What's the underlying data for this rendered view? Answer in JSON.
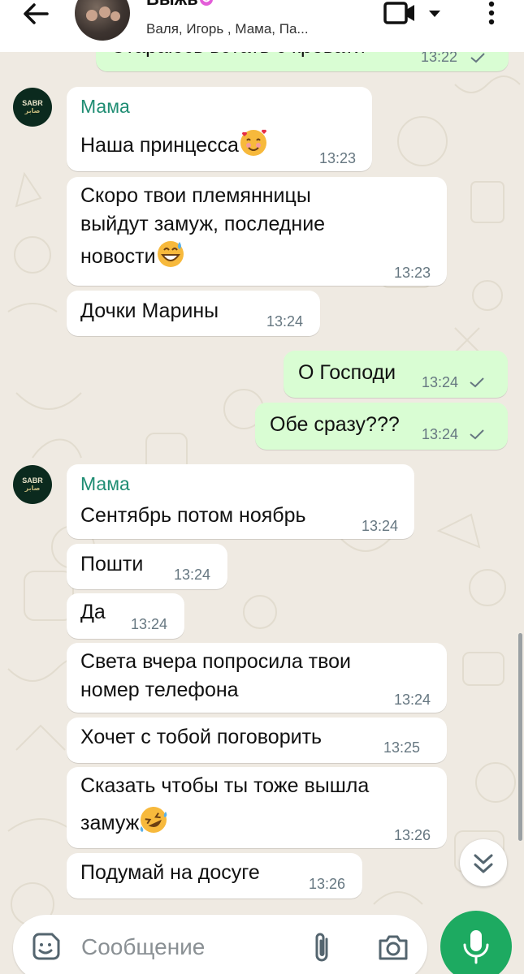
{
  "header": {
    "title": "Выжь",
    "members": "Валя, Игорь , Мама, Па..."
  },
  "messages": [
    {
      "dir": "out",
      "text": "Стараюсь встать с кровати",
      "time": "13:22",
      "status": "sent"
    },
    {
      "dir": "in",
      "sender": "Мама",
      "avatar_text": "SABR",
      "avatar_sub": "صابر",
      "lines": [
        "Наша принцесса"
      ],
      "emoji": "smiling-face-with-hearts",
      "time": "13:23"
    },
    {
      "dir": "in",
      "lines": [
        "Скоро твои племянницы",
        "выйдут замуж, последние",
        "новости"
      ],
      "emoji": "grinning-face-with-sweat",
      "time": "13:23"
    },
    {
      "dir": "in",
      "lines": [
        "Дочки Марины"
      ],
      "time": "13:24"
    },
    {
      "dir": "out",
      "text": "О Господи",
      "time": "13:24",
      "status": "sent"
    },
    {
      "dir": "out",
      "text": "Обе сразу???",
      "time": "13:24",
      "status": "sent"
    },
    {
      "dir": "in",
      "sender": "Мама",
      "avatar_text": "SABR",
      "avatar_sub": "صابر",
      "lines": [
        "Сентябрь потом ноябрь"
      ],
      "time": "13:24"
    },
    {
      "dir": "in",
      "lines": [
        "Пошти"
      ],
      "time": "13:24"
    },
    {
      "dir": "in",
      "lines": [
        "Да"
      ],
      "time": "13:24"
    },
    {
      "dir": "in",
      "lines": [
        "Света вчера попросила твои",
        "номер телефона"
      ],
      "time": "13:24"
    },
    {
      "dir": "in",
      "lines": [
        "Хочет с тобой поговорить"
      ],
      "time": "13:25"
    },
    {
      "dir": "in",
      "lines": [
        "Сказать чтобы ты тоже вышла",
        "замуж"
      ],
      "emoji": "rolling-on-floor-laughing",
      "time": "13:26"
    },
    {
      "dir": "in",
      "lines": [
        "Подумай на досуге"
      ],
      "time": "13:26"
    }
  ],
  "composer": {
    "placeholder": "Сообщение"
  },
  "colors": {
    "accent": "#1daa61",
    "outgoing_bubble": "#d9fdd3",
    "incoming_bubble": "#ffffff",
    "sender_name": "#1f8d73",
    "wallpaper": "#efeae2"
  },
  "icons": [
    "back-arrow-icon",
    "video-call-icon",
    "dropdown-icon",
    "more-vert-icon",
    "scroll-down-icon",
    "sticker-icon",
    "attach-icon",
    "camera-icon",
    "mic-icon",
    "check-icon"
  ]
}
